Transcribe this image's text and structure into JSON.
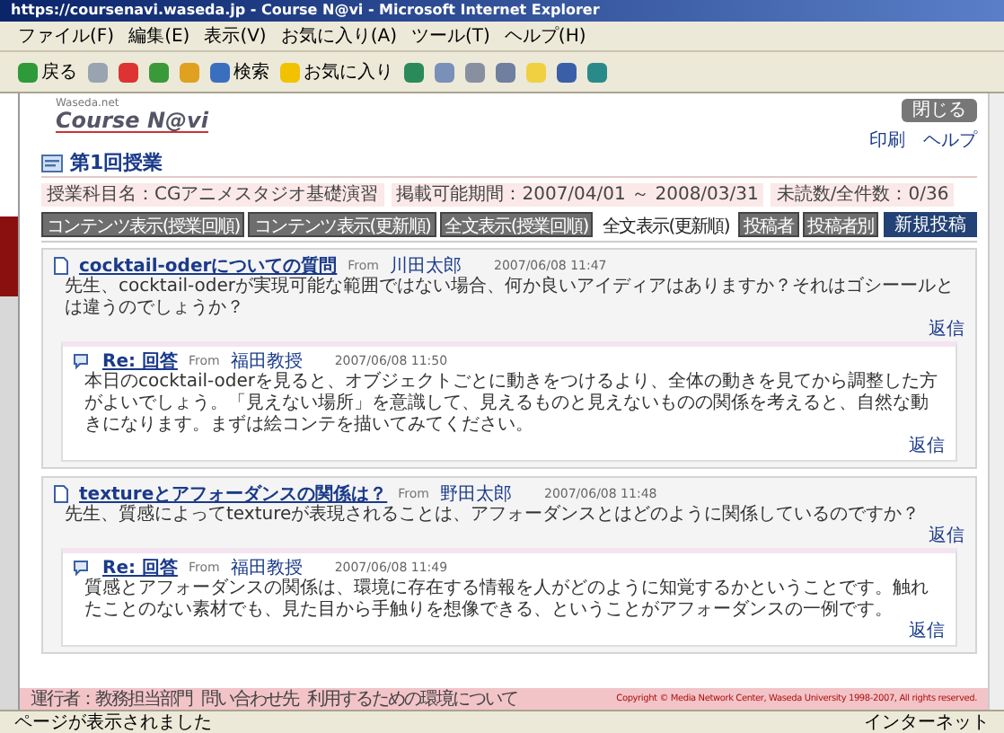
{
  "window": {
    "title": "https://coursenavi.waseda.jp - Course N@vi - Microsoft Internet Explorer"
  },
  "menu": [
    "ファイル(F)",
    "編集(E)",
    "表示(V)",
    "お気に入り(A)",
    "ツール(T)",
    "ヘルプ(H)"
  ],
  "toolbar": [
    {
      "kind": "back",
      "label": "戻る"
    },
    {
      "kind": "forward"
    },
    {
      "kind": "stop"
    },
    {
      "kind": "refresh"
    },
    {
      "kind": "home"
    },
    {
      "kind": "search",
      "label": "検索"
    },
    {
      "kind": "favorites",
      "label": "お気に入り"
    },
    {
      "kind": "history"
    },
    {
      "kind": "mail"
    },
    {
      "kind": "print"
    },
    {
      "kind": "edit"
    },
    {
      "kind": "folder"
    },
    {
      "kind": "messenger"
    },
    {
      "kind": "tool"
    }
  ],
  "header": {
    "logo_small": "Waseda.net",
    "logo": "Course N@vi",
    "close_button": "閉じる",
    "links": [
      "印刷",
      "ヘルプ"
    ]
  },
  "page_title": "第1回授業",
  "info": [
    "授業科目名：CGアニメスタジオ基礎演習",
    "掲載可能期間：2007/04/01 ～ 2008/03/31",
    "未読数/全件数：0/36"
  ],
  "tabs": [
    {
      "label": "コンテンツ表示(授業回順)",
      "selected": false
    },
    {
      "label": "コンテンツ表示(更新順)",
      "selected": false
    },
    {
      "label": "全文表示(授業回順)",
      "selected": false
    },
    {
      "label": "全文表示(更新順)",
      "selected": true
    },
    {
      "label": "投稿者",
      "selected": false
    },
    {
      "label": "投稿者別",
      "selected": false
    }
  ],
  "new_post_button": "新規投稿",
  "posts": [
    {
      "title": "cocktail-oderについての質問",
      "from_label": "From",
      "author": "川田太郎",
      "date": "2007/06/08 11:47",
      "body": "先生、cocktail-oderが実現可能な範囲ではない場合、何か良いアイディアはありますか？それはゴシーールとは違うのでしょうか？",
      "reply_link": "返信",
      "replies": [
        {
          "title": "Re: 回答",
          "from_label": "From",
          "author": "福田教授",
          "date": "2007/06/08 11:50",
          "body": "本日のcocktail-oderを見ると、オブジェクトごとに動きをつけるより、全体の動きを見てから調整した方がよいでしょう。「見えない場所」を意識して、見えるものと見えないものの関係を考えると、自然な動きになります。まずは絵コンテを描いてみてください。",
          "reply_link": "返信"
        }
      ]
    },
    {
      "title": "textureとアフォーダンスの関係は？",
      "from_label": "From",
      "author": "野田太郎",
      "date": "2007/06/08 11:48",
      "body": "先生、質感によってtextureが表現されることは、アフォーダンスとはどのように関係しているのですか？",
      "reply_link": "返信",
      "replies": [
        {
          "title": "Re: 回答",
          "from_label": "From",
          "author": "福田教授",
          "date": "2007/06/08 11:49",
          "body": "質感とアフォーダンスの関係は、環境に存在する情報を人がどのように知覚するかということです。触れたことのない素材でも、見た目から手触りを想像できる、ということがアフォーダンスの一例です。",
          "reply_link": "返信"
        }
      ]
    }
  ],
  "footer": {
    "links": [
      "運行者：教務担当部門",
      "問い合わせ先",
      "利用するための環境について"
    ],
    "copyright": "Copyright © Media Network Center, Waseda University 1998-2007, All rights reserved."
  },
  "status_bar": {
    "text": "ページが表示されました",
    "zone": "インターネット"
  }
}
